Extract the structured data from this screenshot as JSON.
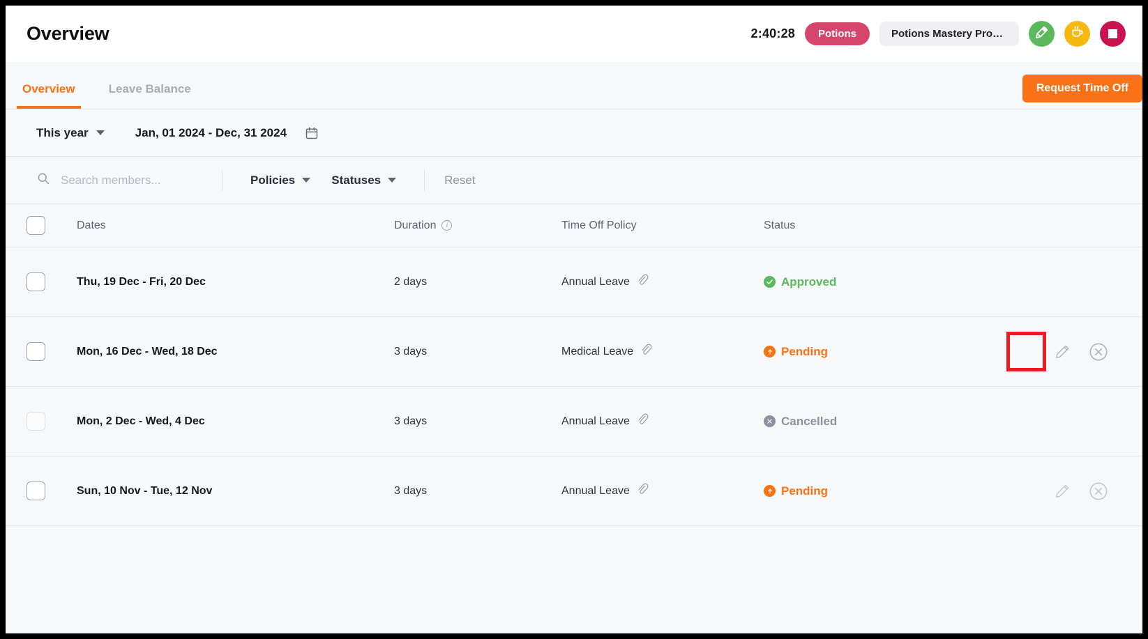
{
  "header": {
    "title": "Overview",
    "timer": "2:40:28",
    "project_chip": "Potions",
    "task_chip": "Potions Mastery Progr...",
    "buttons": [
      {
        "name": "pin-timer-button",
        "icon": "pin-icon",
        "color": "#5cb85c"
      },
      {
        "name": "break-button",
        "icon": "coffee-cup-icon",
        "color": "#f5b912"
      },
      {
        "name": "stop-button",
        "icon": "stop-square-icon",
        "color": "#c8134f"
      }
    ]
  },
  "tabs": {
    "items": [
      {
        "label": "Overview",
        "active": true
      },
      {
        "label": "Leave Balance",
        "active": false
      }
    ],
    "request_button": "Request Time Off"
  },
  "daterange": {
    "preset": "This year",
    "range": "Jan, 01 2024 - Dec, 31 2024",
    "calendar_icon": "calendar-icon"
  },
  "filters": {
    "search_placeholder": "Search members...",
    "search_value": "",
    "policies": "Policies",
    "statuses": "Statuses",
    "reset": "Reset"
  },
  "table": {
    "columns": [
      "Dates",
      "Duration",
      "Time Off Policy",
      "Status"
    ],
    "duration_info_icon": "info-icon",
    "rows": [
      {
        "dates": "Thu, 19 Dec - Fri, 20 Dec",
        "duration": "2 days",
        "policy": "Annual Leave",
        "attachment_icon": "paperclip-icon",
        "status": "Approved",
        "status_kind": "approved",
        "checked": false,
        "checkbox_dim": false,
        "actions": []
      },
      {
        "dates": "Mon, 16 Dec - Wed, 18 Dec",
        "duration": "3 days",
        "policy": "Medical Leave",
        "attachment_icon": "paperclip-icon",
        "status": "Pending",
        "status_kind": "pending",
        "checked": false,
        "checkbox_dim": false,
        "actions": [
          "edit-icon",
          "cancel-icon"
        ],
        "highlighted_action": "edit-icon"
      },
      {
        "dates": "Mon, 2 Dec - Wed, 4 Dec",
        "duration": "3 days",
        "policy": "Annual Leave",
        "attachment_icon": "paperclip-icon",
        "status": "Cancelled",
        "status_kind": "cancelled",
        "checked": false,
        "checkbox_dim": true,
        "actions": []
      },
      {
        "dates": "Sun, 10 Nov - Tue, 12 Nov",
        "duration": "3 days",
        "policy": "Annual Leave",
        "attachment_icon": "paperclip-icon",
        "status": "Pending",
        "status_kind": "pending",
        "checked": false,
        "checkbox_dim": false,
        "actions": [
          "edit-icon",
          "cancel-icon"
        ]
      }
    ]
  },
  "colors": {
    "accent": "#f97316",
    "approved": "#5cb85c",
    "pending": "#f97316",
    "cancelled": "#8c919d",
    "project_chip": "#d6456b",
    "highlight": "#ed1c24",
    "page_bg": "#f7f8fa"
  }
}
